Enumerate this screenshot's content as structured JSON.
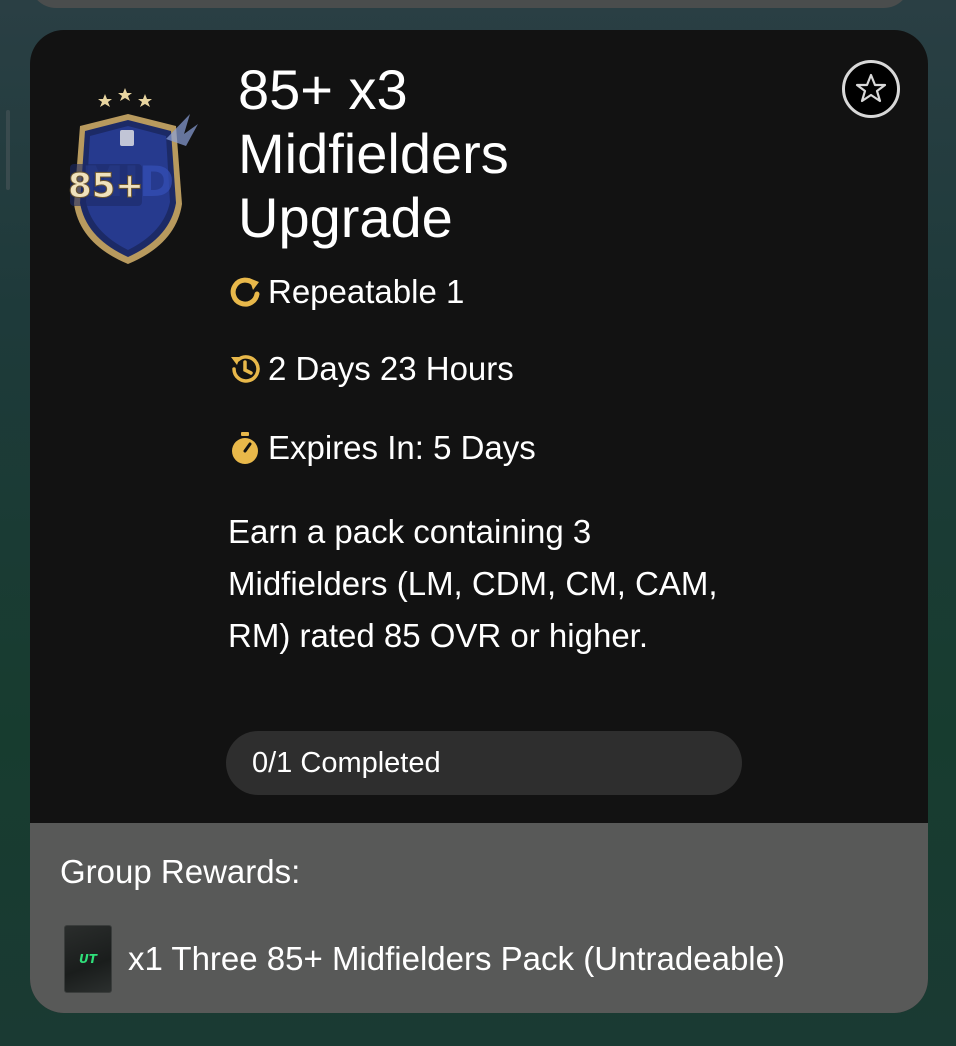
{
  "objective": {
    "title_line1": "85+ x3",
    "title_line2": "Midfielders",
    "title_line3": "Upgrade",
    "badge_text": "85+",
    "repeatable": "Repeatable 1",
    "time_remaining": "2 Days 23 Hours",
    "expires": "Expires In: 5 Days",
    "description": "Earn a pack containing 3 Midfielders (LM, CDM, CM, CAM, RM) rated 85 OVR or higher.",
    "progress_text": "0/1 Completed",
    "progress_fraction": 0,
    "favorite_icon": "star-outline-icon"
  },
  "rewards": {
    "label": "Group Rewards:",
    "items": [
      {
        "pack_logo": "UT",
        "text": "x1 Three 85+ Midfielders Pack (Untradeable)"
      }
    ]
  },
  "colors": {
    "card_bg": "#121212",
    "rewards_bg": "#585958",
    "accent_gold": "#e8b84a",
    "pack_logo_green": "#2fe07a"
  }
}
